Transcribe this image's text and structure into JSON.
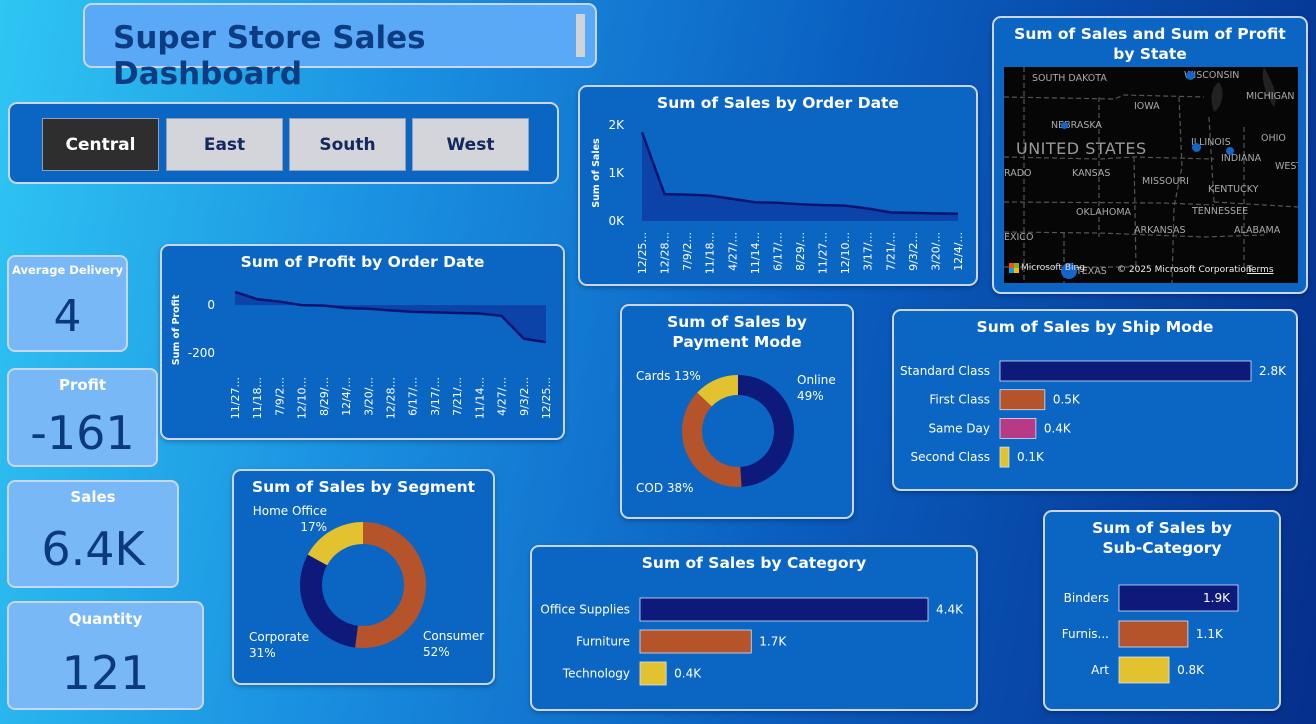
{
  "header": {
    "title": "Super Store Sales Dashboard"
  },
  "slicer": {
    "regions": [
      "Central",
      "East",
      "South",
      "West"
    ],
    "selected": "Central"
  },
  "kpis": {
    "avg_delivery": {
      "label": "Average Delivery",
      "value": "4"
    },
    "profit": {
      "label": "Profit",
      "value": "-161"
    },
    "sales": {
      "label": "Sales",
      "value": "6.4K"
    },
    "quantity": {
      "label": "Quantity",
      "value": "121"
    }
  },
  "colors": {
    "navy": "#0d1a7a",
    "orange": "#b5532a",
    "yellow": "#e2c22f",
    "magenta": "#b63a86",
    "panel": "#0b66c3"
  },
  "map": {
    "title": "Sum of Sales and Sum of Profit by State",
    "country_label": "UNITED STATES",
    "attribution_logo": "Microsoft Bing",
    "copyright": "© 2025 Microsoft Corporation",
    "terms": "Terms",
    "place_labels": [
      "SOUTH DAKOTA",
      "WISCONSIN",
      "MICHIGAN",
      "IOWA",
      "NEBRASKA",
      "ILLINOIS",
      "OHIO",
      "INDIANA",
      "WEST",
      "RADO",
      "KANSAS",
      "MISSOURI",
      "KENTUCKY",
      "OKLAHOMA",
      "TENNESSEE",
      "EXICO",
      "ARKANSAS",
      "ALABAMA",
      "TEXAS"
    ]
  },
  "chart_data": [
    {
      "id": "sales_by_order_date",
      "type": "area",
      "title": "Sum of Sales by Order Date",
      "ylabel": "Sum of Sales",
      "ylim": [
        0,
        2000
      ],
      "yticks": [
        "2K",
        "1K",
        "0K"
      ],
      "x": [
        "12/25...",
        "12/28...",
        "7/9/2...",
        "11/18...",
        "4/27/...",
        "11/14...",
        "6/17/...",
        "8/29/...",
        "11/27...",
        "12/10...",
        "3/17/...",
        "7/21/...",
        "9/3/2...",
        "3/20/...",
        "12/4/..."
      ],
      "values": [
        1850,
        560,
        550,
        530,
        460,
        390,
        380,
        350,
        330,
        320,
        260,
        180,
        170,
        160,
        150
      ]
    },
    {
      "id": "profit_by_order_date",
      "type": "area",
      "title": "Sum of Profit by Order Date",
      "ylabel": "Sum of Profit",
      "ylim": [
        -250,
        80
      ],
      "yticks": [
        "0",
        "-200"
      ],
      "x": [
        "11/27...",
        "11/18...",
        "7/9/2...",
        "12/10...",
        "8/29/...",
        "12/4/...",
        "3/20/...",
        "12/28...",
        "6/17/...",
        "3/17/...",
        "7/21/...",
        "11/14...",
        "4/27/...",
        "9/3/2...",
        "12/25..."
      ],
      "values": [
        55,
        25,
        15,
        0,
        -2,
        -12,
        -15,
        -22,
        -28,
        -30,
        -33,
        -35,
        -45,
        -140,
        -155
      ]
    },
    {
      "id": "sales_by_payment_mode",
      "type": "pie",
      "title": "Sum of Sales by Payment Mode",
      "categories": [
        "Online",
        "COD",
        "Cards"
      ],
      "values": [
        49,
        38,
        13
      ],
      "labels": [
        "Online\n49%",
        "COD 38%",
        "Cards 13%"
      ]
    },
    {
      "id": "sales_by_ship_mode",
      "type": "bar",
      "title": "Sum of Sales by Ship Mode",
      "categories": [
        "Standard Class",
        "First Class",
        "Same Day",
        "Second Class"
      ],
      "values": [
        2.8,
        0.5,
        0.4,
        0.1
      ],
      "value_labels": [
        "2.8K",
        "0.5K",
        "0.4K",
        "0.1K"
      ]
    },
    {
      "id": "sales_by_segment",
      "type": "pie",
      "title": "Sum of Sales by Segment",
      "categories": [
        "Consumer",
        "Corporate",
        "Home Office"
      ],
      "values": [
        52,
        31,
        17
      ],
      "labels": [
        "Consumer\n52%",
        "Corporate\n31%",
        "Home Office\n17%"
      ]
    },
    {
      "id": "sales_by_category",
      "type": "bar",
      "title": "Sum of Sales by Category",
      "categories": [
        "Office Supplies",
        "Furniture",
        "Technology"
      ],
      "values": [
        4.4,
        1.7,
        0.4
      ],
      "value_labels": [
        "4.4K",
        "1.7K",
        "0.4K"
      ]
    },
    {
      "id": "sales_by_sub_category",
      "type": "bar",
      "title": "Sum of Sales by Sub-Category",
      "categories": [
        "Binders",
        "Furnis...",
        "Art"
      ],
      "values": [
        1.9,
        1.1,
        0.8
      ],
      "value_labels": [
        "1.9K",
        "1.1K",
        "0.8K"
      ]
    }
  ]
}
